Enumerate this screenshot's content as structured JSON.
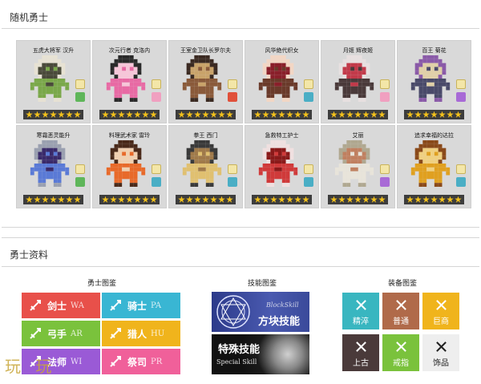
{
  "random_heroes": {
    "title": "随机勇士",
    "cards": [
      {
        "name": "五虎大将军 汉升",
        "colors": [
          "#7aa84a",
          "#e7e2d3",
          "#4a4a3a"
        ],
        "badge2": "#5fb65a"
      },
      {
        "name": "次元行者 克洛内",
        "colors": [
          "#e86aa4",
          "#2a2a2a",
          "#f7c6d9"
        ],
        "badge2": "#f0a0c0"
      },
      {
        "name": "王室金卫队长罗尔夫",
        "colors": [
          "#8a5a3a",
          "#3b2a22",
          "#c9a36a"
        ],
        "badge2": "#e0503a"
      },
      {
        "name": "风华绝代织女",
        "colors": [
          "#6a3a2a",
          "#f2d6c4",
          "#8a1f2a"
        ],
        "badge2": "#4aaec5"
      },
      {
        "name": "月姬 辉夜姬",
        "colors": [
          "#4a3a3a",
          "#e8e0e0",
          "#c23a4a"
        ],
        "badge2": "#f0a0c0"
      },
      {
        "name": "百王 菊花",
        "colors": [
          "#4a4a6a",
          "#8a5aa8",
          "#e0d0a8"
        ],
        "badge2": "#a86ad6"
      },
      {
        "name": "寒霜恶灵能升",
        "colors": [
          "#5a7ad6",
          "#9aa0b0",
          "#3a2a6a"
        ],
        "badge2": "#5fb65a"
      },
      {
        "name": "料理武术家 雷玲",
        "colors": [
          "#e86a2a",
          "#4a2a1a",
          "#f0d0b0"
        ],
        "badge2": "#4aaec5"
      },
      {
        "name": "拳王 西门",
        "colors": [
          "#e0c070",
          "#3a3a3a",
          "#a07a4a"
        ],
        "badge2": "#4aaec5"
      },
      {
        "name": "急救特工护士",
        "colors": [
          "#d03a3a",
          "#f0e0e0",
          "#8a1a1a"
        ],
        "badge2": "#4aaec5"
      },
      {
        "name": "艾丽",
        "colors": [
          "#e8e4da",
          "#b0a890",
          "#c08060"
        ],
        "badge2": "#a86ad6"
      },
      {
        "name": "追求幸福的达拉",
        "colors": [
          "#e0a020",
          "#8a4a1a",
          "#f0d080"
        ],
        "badge2": "#4aaec5"
      }
    ]
  },
  "hero_info": {
    "title": "勇士资料",
    "hero_guide": {
      "label": "勇士图鉴",
      "tiles": [
        {
          "zh": "剑士",
          "en": "WA",
          "color": "#e8504a"
        },
        {
          "zh": "骑士",
          "en": "PA",
          "color": "#39b6d3"
        },
        {
          "zh": "弓手",
          "en": "AR",
          "color": "#7ac23c"
        },
        {
          "zh": "猎人",
          "en": "HU",
          "color": "#f0b41c"
        },
        {
          "zh": "法师",
          "en": "WI",
          "color": "#9a5ad6"
        },
        {
          "zh": "祭司",
          "en": "PR",
          "color": "#f0609a"
        }
      ]
    },
    "skill_guide": {
      "label": "技能图鉴",
      "block_zh": "方块技能",
      "block_en": "BlockSkill",
      "special_zh": "特殊技能",
      "special_en": "Special Skill"
    },
    "equip_guide": {
      "label": "装备图鉴",
      "tiles": [
        {
          "zh": "精淬",
          "color": "#39b6c0"
        },
        {
          "zh": "普通",
          "color": "#b06a4a"
        },
        {
          "zh": "巨商",
          "color": "#f0b41c"
        },
        {
          "zh": "上古",
          "color": "#4a3a3a"
        },
        {
          "zh": "戒指",
          "color": "#7ac23c"
        },
        {
          "zh": "饰品",
          "color": "#eeeeee"
        }
      ]
    }
  },
  "watermark": "玩 玩"
}
